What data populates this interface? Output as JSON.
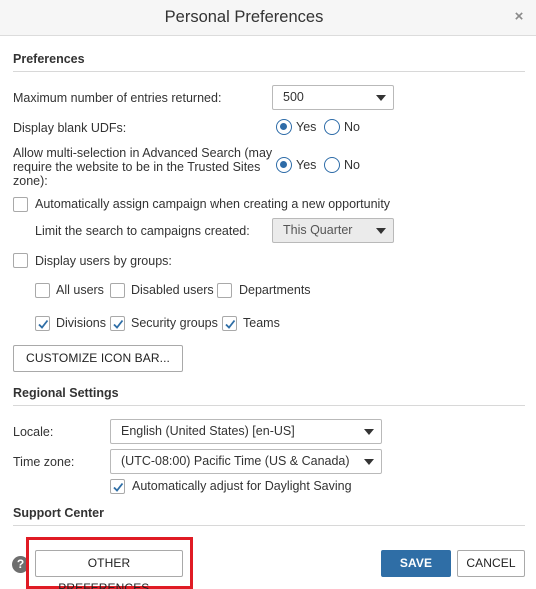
{
  "dialog": {
    "title": "Personal Preferences",
    "close_glyph": "×"
  },
  "preferences": {
    "section_title": "Preferences",
    "max_entries": {
      "label": "Maximum number of entries returned:",
      "value": "500"
    },
    "blank_udfs": {
      "label": "Display blank UDFs:",
      "yes": "Yes",
      "no": "No",
      "selected": "Yes"
    },
    "multi_selection": {
      "label_line1": "Allow multi-selection in Advanced Search (may",
      "label_line2": "require the website to be in the Trusted Sites",
      "label_line3": "zone):",
      "yes": "Yes",
      "no": "No",
      "selected": "Yes"
    },
    "auto_campaign": {
      "label": "Automatically assign campaign when creating a new opportunity",
      "checked": false
    },
    "limit_search": {
      "label": "Limit the search to campaigns created:",
      "value": "This Quarter",
      "disabled": true
    },
    "users_by_groups": {
      "label": "Display users by groups:",
      "checked": false
    },
    "groups": {
      "all_users": {
        "label": "All users",
        "checked": false
      },
      "disabled_users": {
        "label": "Disabled users",
        "checked": false
      },
      "departments": {
        "label": "Departments",
        "checked": false
      },
      "divisions": {
        "label": "Divisions",
        "checked": true
      },
      "security_groups": {
        "label": "Security groups",
        "checked": true
      },
      "teams": {
        "label": "Teams",
        "checked": true
      }
    },
    "customize_button": "CUSTOMIZE ICON BAR..."
  },
  "regional": {
    "section_title": "Regional Settings",
    "locale": {
      "label": "Locale:",
      "value": "English (United States) [en-US]"
    },
    "timezone": {
      "label": "Time zone:",
      "value": "(UTC-08:00) Pacific Time (US & Canada)"
    },
    "daylight": {
      "label": "Automatically adjust for Daylight Saving",
      "checked": true
    }
  },
  "support": {
    "section_title": "Support Center"
  },
  "footer": {
    "help_glyph": "?",
    "other_preferences": "OTHER PREFERENCES...",
    "save": "SAVE",
    "cancel": "CANCEL"
  },
  "colors": {
    "accent": "#2f6ea6",
    "highlight": "#e01b24"
  }
}
